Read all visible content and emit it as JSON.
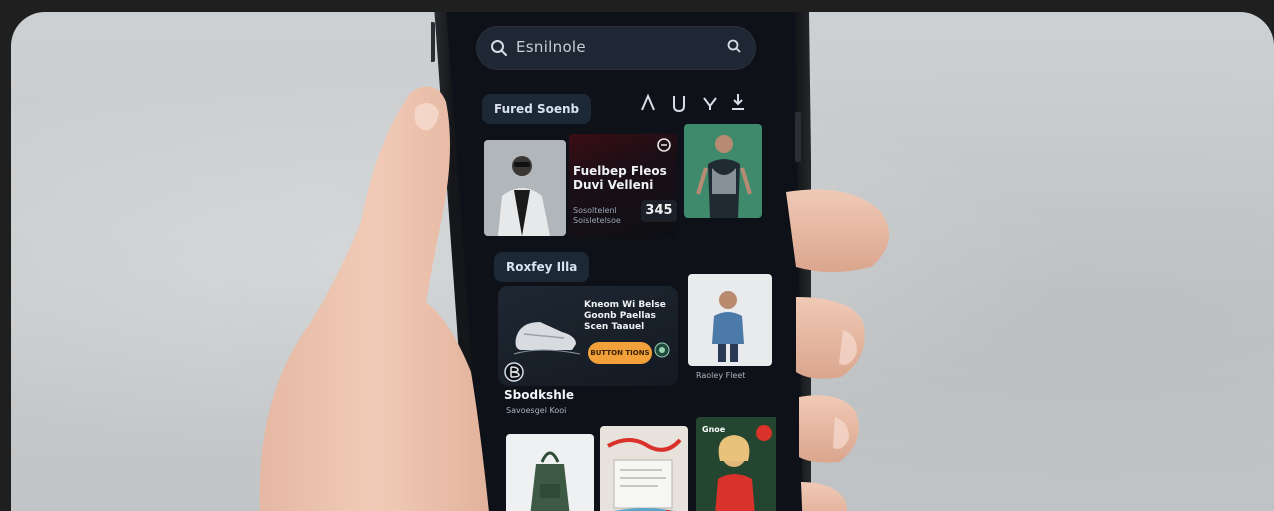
{
  "screen": {
    "search_placeholder": "Esnilnole",
    "section_1_label": "Fured Soenb",
    "featured_card_title": "Fuelbep Fleos Duvi Velleni",
    "featured_card_sub": "Sosoltelenl Soisletelsoe",
    "featured_card_number": "345",
    "section_2_label": "Roxfey Illa",
    "promo_card_text": "Kneom Wi Belse Goonb Paellas Scen Taauel",
    "promo_button_label": "BUTTON TIONS",
    "promo_side_label": "Raoley Fleet",
    "lower_label_title": "Sbodkshle",
    "lower_label_sub": "Savoesgel Kooi",
    "card_3_label": "Gnoe"
  },
  "colors": {
    "screen_bg": "#0f141b",
    "accent_orange": "#f2a03a",
    "accent_red": "#d8322b"
  }
}
